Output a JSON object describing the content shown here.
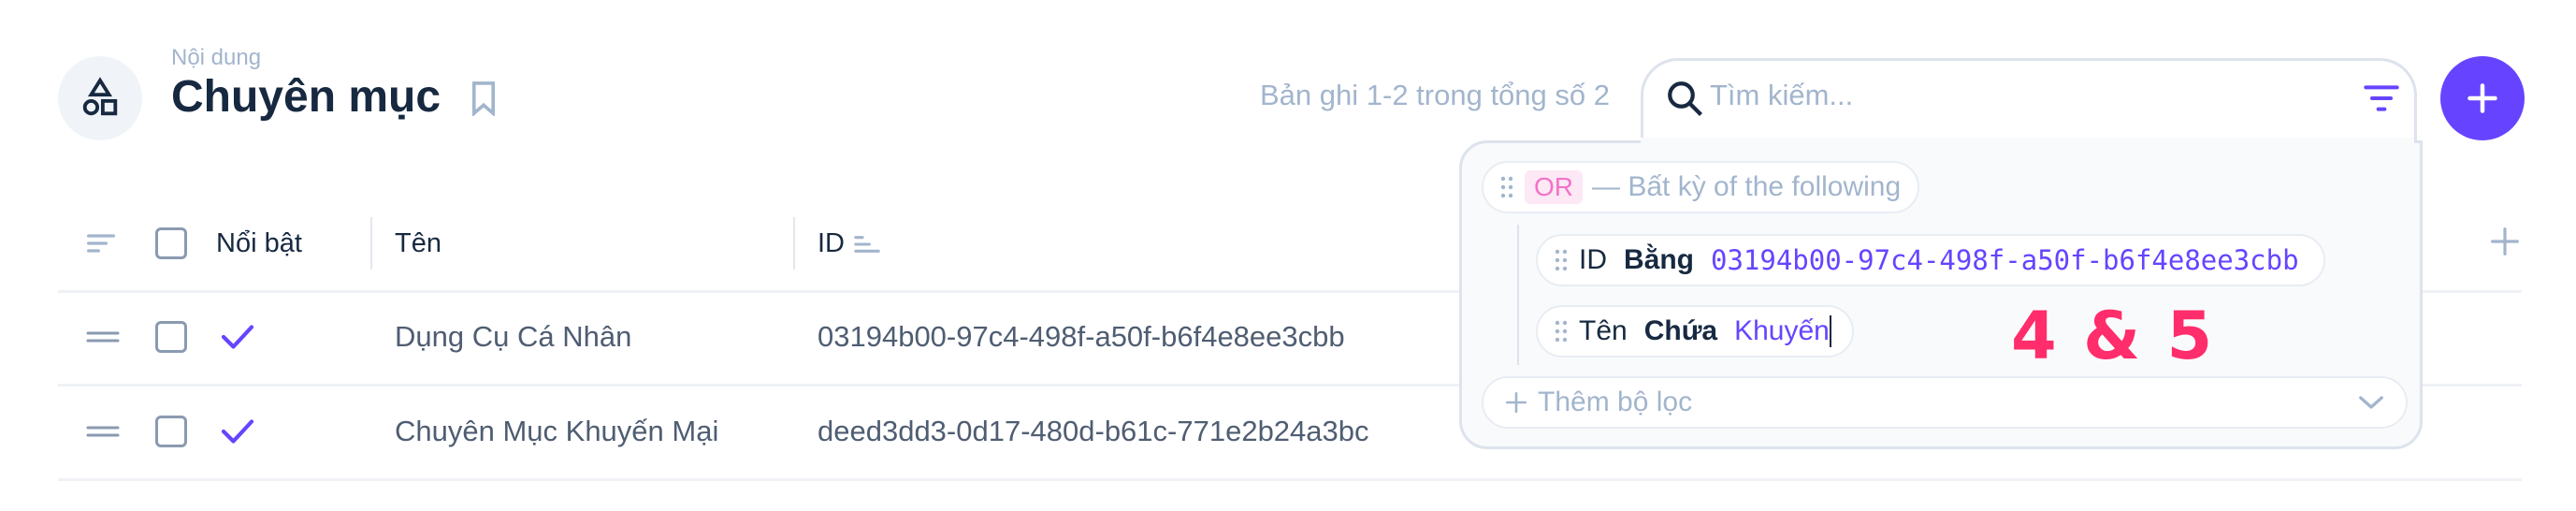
{
  "header": {
    "breadcrumb": "Nội dung",
    "title": "Chuyên mục",
    "icon": "shapes-icon",
    "bookmark_icon": "bookmark-icon"
  },
  "toolbar": {
    "record_count": "Bản ghi 1-2 trong tổng số 2",
    "search_placeholder": "Tìm kiếm...",
    "add_icon": "plus-icon",
    "accent": "#6644ff"
  },
  "filter": {
    "group_badge": "OR",
    "group_label": "— Bất kỳ of the following",
    "rules": [
      {
        "field": "ID",
        "operator": "Bằng",
        "value": "03194b00-97c4-498f-a50f-b6f4e8ee3cbb"
      },
      {
        "field": "Tên",
        "operator": "Chứa",
        "value": "Khuyến"
      }
    ],
    "add_filter_label": "Thêm bộ lọc"
  },
  "annotation": "4 & 5",
  "table": {
    "columns": [
      "Nổi bật",
      "Tên",
      "ID"
    ],
    "rows": [
      {
        "featured": true,
        "name": "Dụng Cụ Cá Nhân",
        "id": "03194b00-97c4-498f-a50f-b6f4e8ee3cbb"
      },
      {
        "featured": true,
        "name": "Chuyên Mục Khuyến Mại",
        "id": "deed3dd3-0d17-480d-b61c-771e2b24a3bc"
      }
    ]
  }
}
